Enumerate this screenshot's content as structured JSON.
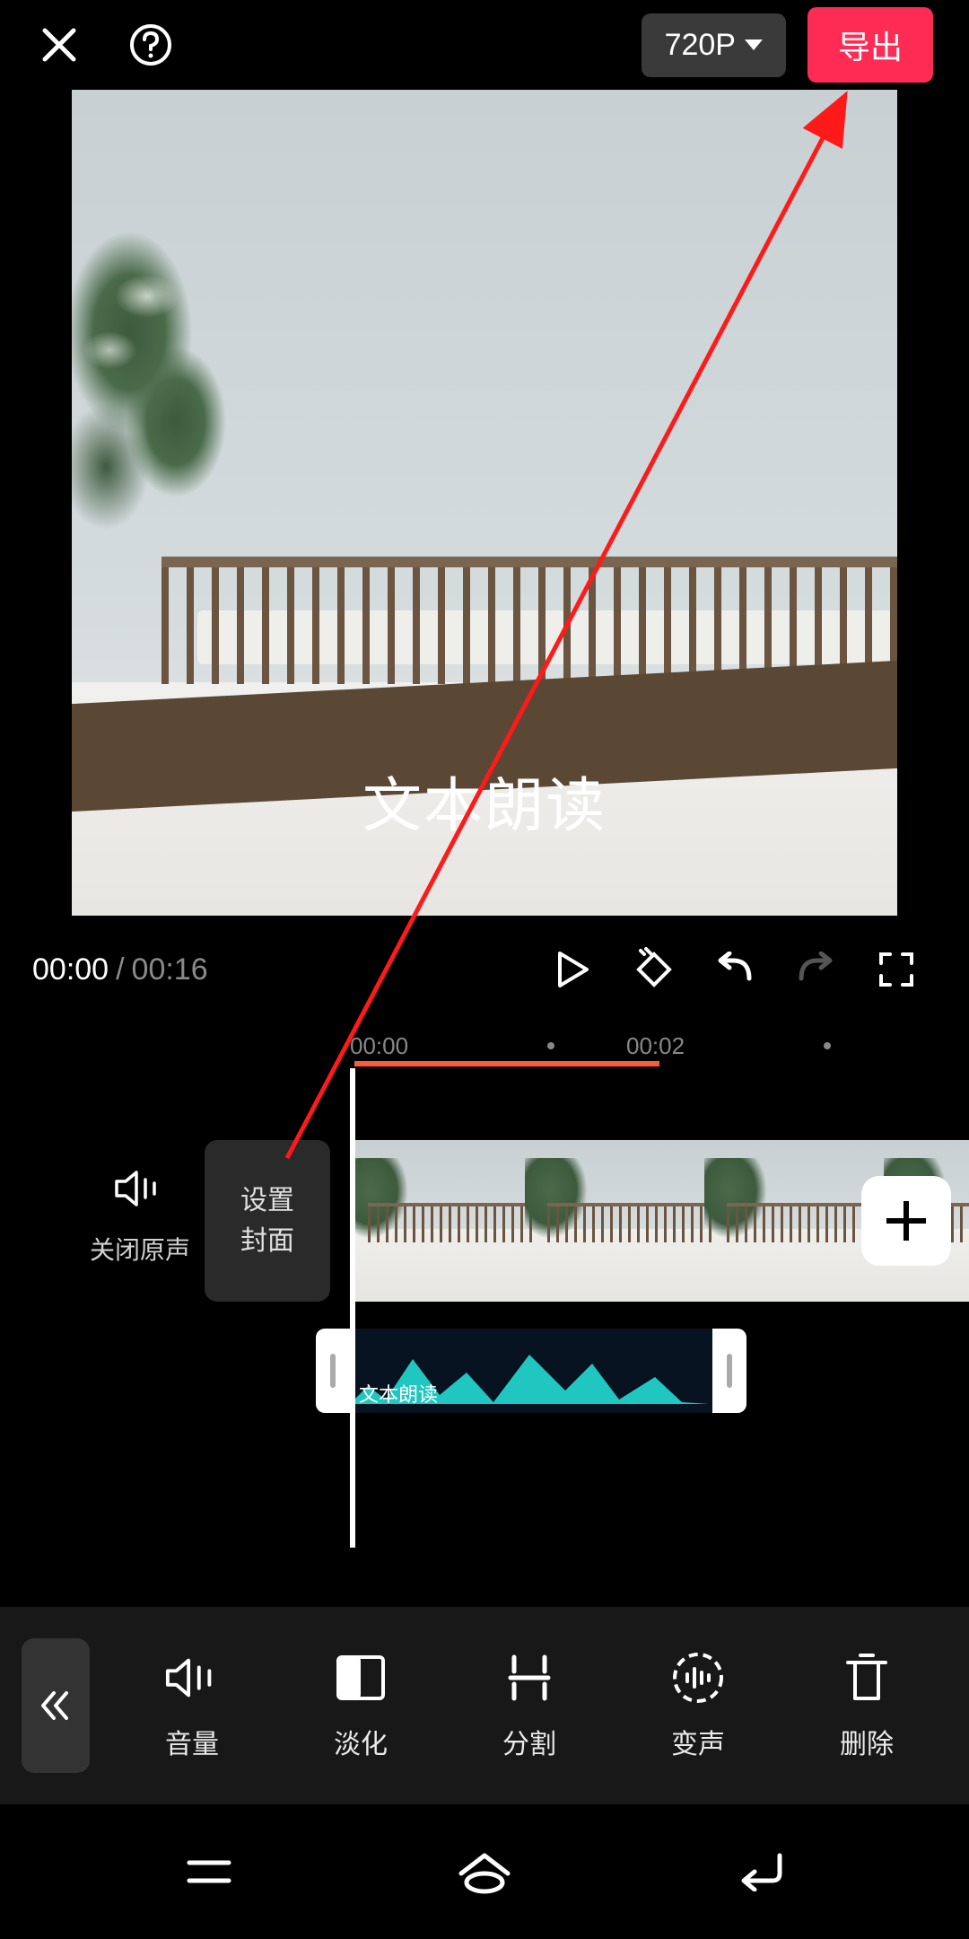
{
  "topbar": {
    "resolution_label": "720P",
    "export_label": "导出"
  },
  "preview": {
    "overlay_text": "文本朗读"
  },
  "playback": {
    "current_time": "00:00",
    "duration": "00:16"
  },
  "ruler": {
    "marks": [
      "00:00",
      "00:02"
    ]
  },
  "timeline": {
    "mute_label": "关闭原声",
    "cover_button_label": "设置\n封面",
    "audio_clip_label": "文本朗读"
  },
  "toolbar": {
    "items": [
      {
        "label": "音量"
      },
      {
        "label": "淡化"
      },
      {
        "label": "分割"
      },
      {
        "label": "变声"
      },
      {
        "label": "删除"
      }
    ]
  }
}
